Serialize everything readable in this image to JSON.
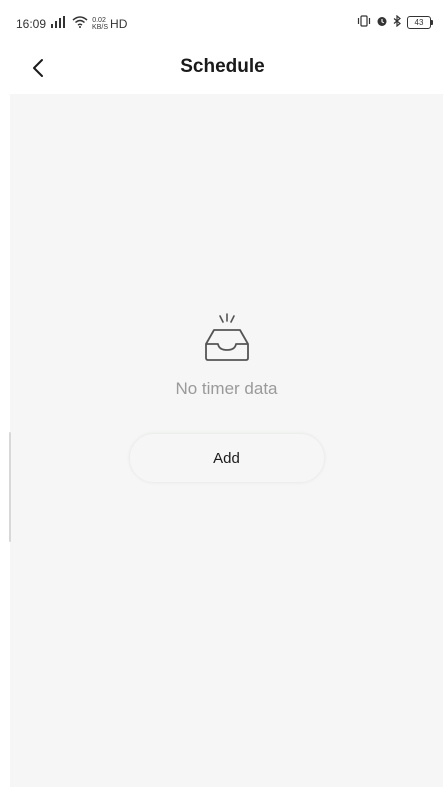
{
  "status_bar": {
    "time": "16:09",
    "network_signal": "4G",
    "net_speed_top": "0.02",
    "net_speed_bottom": "KB/S",
    "hd": "HD",
    "battery": "43"
  },
  "header": {
    "title": "Schedule"
  },
  "empty_state": {
    "message": "No timer data",
    "add_label": "Add"
  },
  "icons": {
    "back": "chevron-left-icon",
    "empty": "empty-tray-icon"
  },
  "colors": {
    "background": "#f5f6f5",
    "header_bg": "#ffffff",
    "muted_text": "#9a9a9a"
  }
}
